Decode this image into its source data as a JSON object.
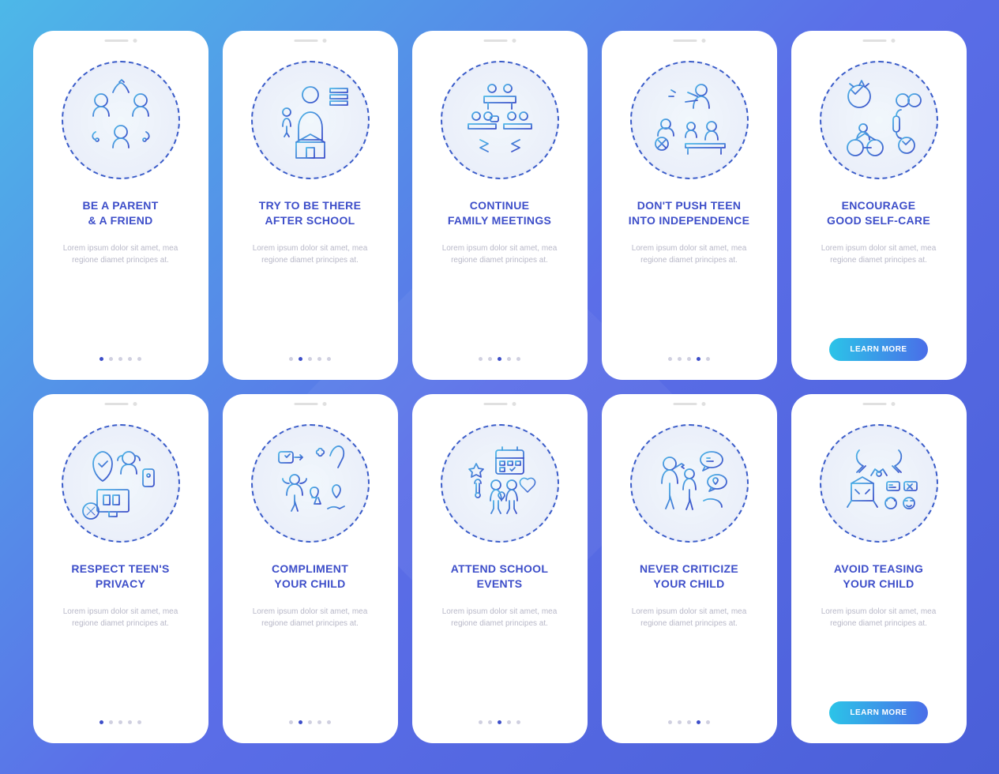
{
  "body_text": "Lorem ipsum dolor sit amet, mea regione diamet principes at.",
  "button_label": "LEARN MORE",
  "cards": [
    {
      "title": "BE A PARENT\n& A FRIEND",
      "active_dot": 0,
      "has_button": false
    },
    {
      "title": "TRY TO BE THERE\nAFTER SCHOOL",
      "active_dot": 1,
      "has_button": false
    },
    {
      "title": "CONTINUE\nFAMILY MEETINGS",
      "active_dot": 2,
      "has_button": false
    },
    {
      "title": "DON'T PUSH TEEN\nINTO INDEPENDENCE",
      "active_dot": 3,
      "has_button": false
    },
    {
      "title": "ENCOURAGE\nGOOD SELF-CARE",
      "active_dot": 4,
      "has_button": true
    },
    {
      "title": "RESPECT TEEN'S\nPRIVACY",
      "active_dot": 0,
      "has_button": false
    },
    {
      "title": "COMPLIMENT\nYOUR CHILD",
      "active_dot": 1,
      "has_button": false
    },
    {
      "title": "ATTEND SCHOOL\nEVENTS",
      "active_dot": 2,
      "has_button": false
    },
    {
      "title": "NEVER CRITICIZE\nYOUR CHILD",
      "active_dot": 3,
      "has_button": false
    },
    {
      "title": "AVOID TEASING\nYOUR CHILD",
      "active_dot": 4,
      "has_button": true
    }
  ],
  "colors": {
    "gradient_start": "#4db8e8",
    "gradient_end": "#3d4ec9"
  }
}
